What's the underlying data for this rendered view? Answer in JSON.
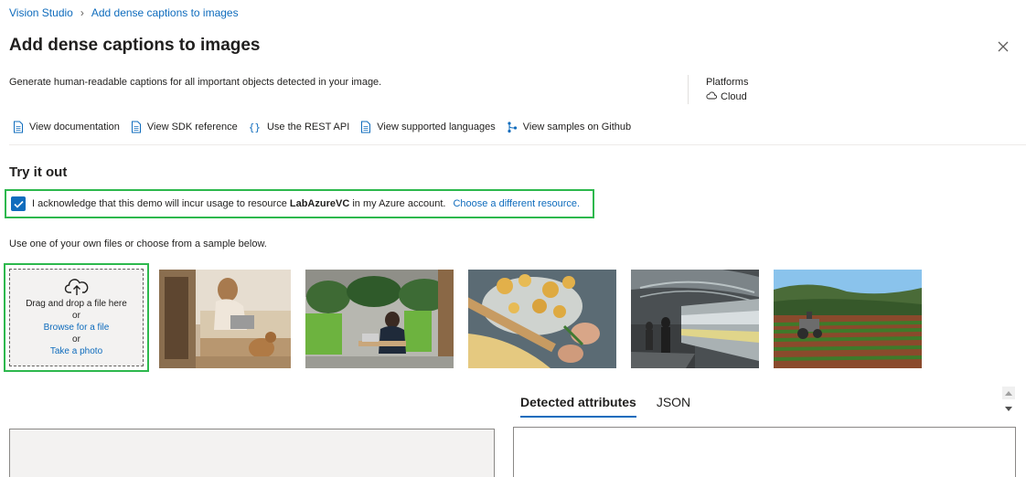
{
  "breadcrumb": {
    "root": "Vision Studio",
    "current": "Add dense captions to images"
  },
  "page": {
    "title": "Add dense captions to images",
    "description": "Generate human-readable captions for all important objects detected in your image."
  },
  "platforms": {
    "title": "Platforms",
    "value": "Cloud",
    "icon": "cloud-icon"
  },
  "links": [
    {
      "label": "View documentation",
      "icon": "document-icon"
    },
    {
      "label": "View SDK reference",
      "icon": "document-icon"
    },
    {
      "label": "Use the REST API",
      "icon": "braces-icon"
    },
    {
      "label": "View supported languages",
      "icon": "document-icon"
    },
    {
      "label": "View samples on Github",
      "icon": "branch-icon"
    }
  ],
  "try_it_out": {
    "title": "Try it out",
    "ack_prefix": "I acknowledge that this demo will incur usage to resource ",
    "resource_name": "LabAzureVC",
    "ack_suffix": " in my Azure account.",
    "ack_checked": true,
    "change_resource_link": "Choose a different resource.",
    "hint": "Use one of your own files or choose from a sample below."
  },
  "upload": {
    "drag_text": "Drag and drop a file here",
    "or1": "or",
    "browse_link": "Browse for a file",
    "or2": "or",
    "photo_link": "Take a photo"
  },
  "samples": [
    "Woman with laptop on bed with a dog",
    "Person working on laptop in office with plants",
    "Hands preparing pasta on a table",
    "Train station with moving train",
    "Tractor in a farm field"
  ],
  "result_tabs": {
    "active": "Detected attributes",
    "other": "JSON"
  },
  "colors": {
    "accent": "#0f6cbd",
    "highlight_border": "#2db84d"
  }
}
